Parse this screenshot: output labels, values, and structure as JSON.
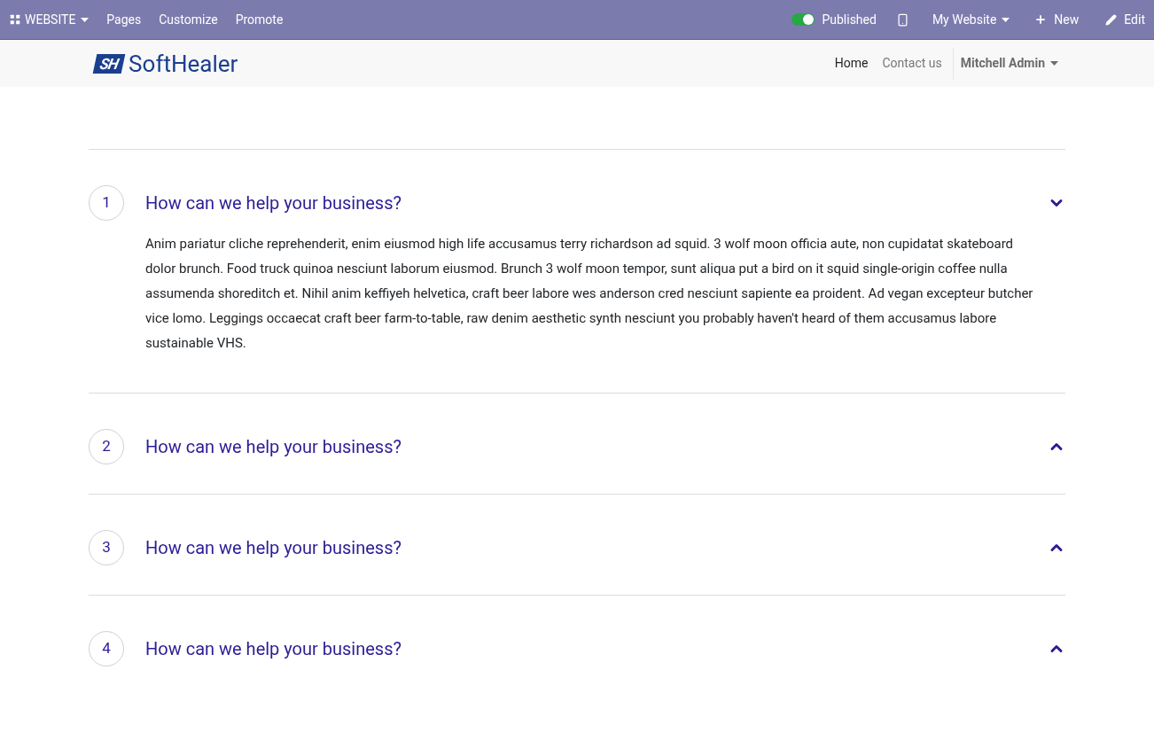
{
  "admin_bar": {
    "app_menu": "WEBSITE",
    "menu": [
      "Pages",
      "Customize",
      "Promote"
    ],
    "published": {
      "on": true,
      "label": "Published"
    },
    "website_menu": "My Website",
    "new_button": "New",
    "edit_button": "Edit"
  },
  "header": {
    "logo_mark": "SH",
    "logo_text": "SoftHealer",
    "nav": [
      {
        "label": "Home",
        "selected": true
      },
      {
        "label": "Contact us",
        "selected": false
      }
    ],
    "user": "Mitchell Admin"
  },
  "faq": [
    {
      "number": "1",
      "question": "How can we help your business?",
      "expanded": true,
      "answer": "Anim pariatur cliche reprehenderit, enim eiusmod high life accusamus terry richardson ad squid. 3 wolf moon officia aute, non cupidatat skateboard dolor brunch. Food truck quinoa nesciunt laborum eiusmod. Brunch 3 wolf moon tempor, sunt aliqua put a bird on it squid single-origin coffee nulla assumenda shoreditch et. Nihil anim keffiyeh helvetica, craft beer labore wes anderson cred nesciunt sapiente ea proident. Ad vegan excepteur butcher vice lomo. Leggings occaecat craft beer farm-to-table, raw denim aesthetic synth nesciunt you probably haven't heard of them accusamus labore sustainable VHS."
    },
    {
      "number": "2",
      "question": "How can we help your business?",
      "expanded": false
    },
    {
      "number": "3",
      "question": "How can we help your business?",
      "expanded": false
    },
    {
      "number": "4",
      "question": "How can we help your business?",
      "expanded": false
    }
  ]
}
